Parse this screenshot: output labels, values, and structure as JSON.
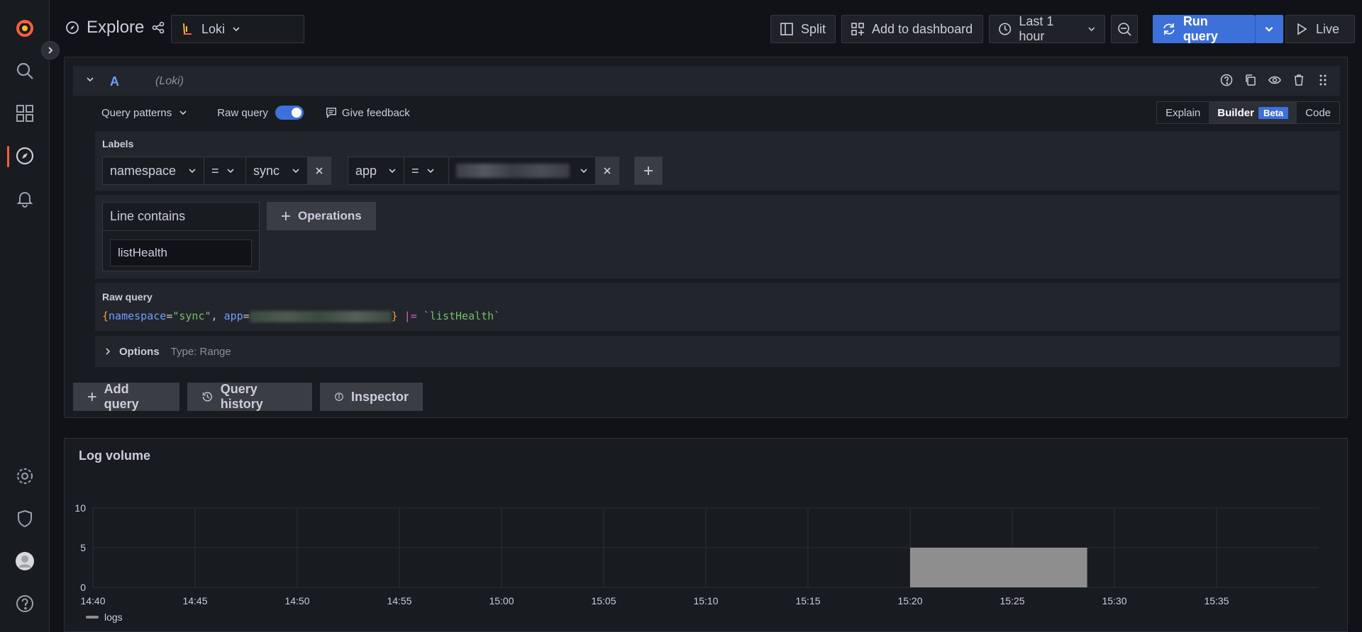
{
  "header": {
    "title": "Explore",
    "datasource": "Loki",
    "split": "Split",
    "add_to_dashboard": "Add to dashboard",
    "time_range": "Last 1 hour",
    "run_query": "Run query",
    "live": "Live"
  },
  "query": {
    "letter": "A",
    "datasource": "(Loki)",
    "query_patterns": "Query patterns",
    "raw_query_toggle": "Raw query",
    "give_feedback": "Give feedback",
    "modes": {
      "explain": "Explain",
      "builder": "Builder",
      "beta": "Beta",
      "code": "Code"
    },
    "labels_title": "Labels",
    "label1": {
      "key": "namespace",
      "op": "=",
      "value": "sync"
    },
    "label2": {
      "key": "app",
      "op": "="
    },
    "operation": {
      "title": "Line contains",
      "value": "listHealth"
    },
    "operations_button": "Operations",
    "raw_title": "Raw query",
    "raw": {
      "open": "{",
      "k1": "namespace",
      "eq": "=",
      "v1": "\"sync\"",
      "comma": ", ",
      "k2": "app",
      "close": "}",
      "pipe": "|=",
      "v2": "`listHealth`"
    },
    "options_label": "Options",
    "options_type": "Type: Range"
  },
  "actions": {
    "add_query": "Add query",
    "query_history": "Query history",
    "inspector": "Inspector"
  },
  "chart_data": {
    "type": "bar",
    "title": "Log volume",
    "x_ticks": [
      "14:40",
      "14:45",
      "14:50",
      "14:55",
      "15:00",
      "15:05",
      "15:10",
      "15:15",
      "15:20",
      "15:25",
      "15:30",
      "15:35"
    ],
    "y_ticks": [
      "0",
      "5",
      "10"
    ],
    "ylim": [
      0,
      10
    ],
    "series": [
      {
        "name": "logs",
        "color": "#8e8e8e",
        "bars": [
          {
            "start": "15:20",
            "end": "15:28:40",
            "value": 5
          }
        ]
      }
    ],
    "legend": "bottom-left"
  }
}
